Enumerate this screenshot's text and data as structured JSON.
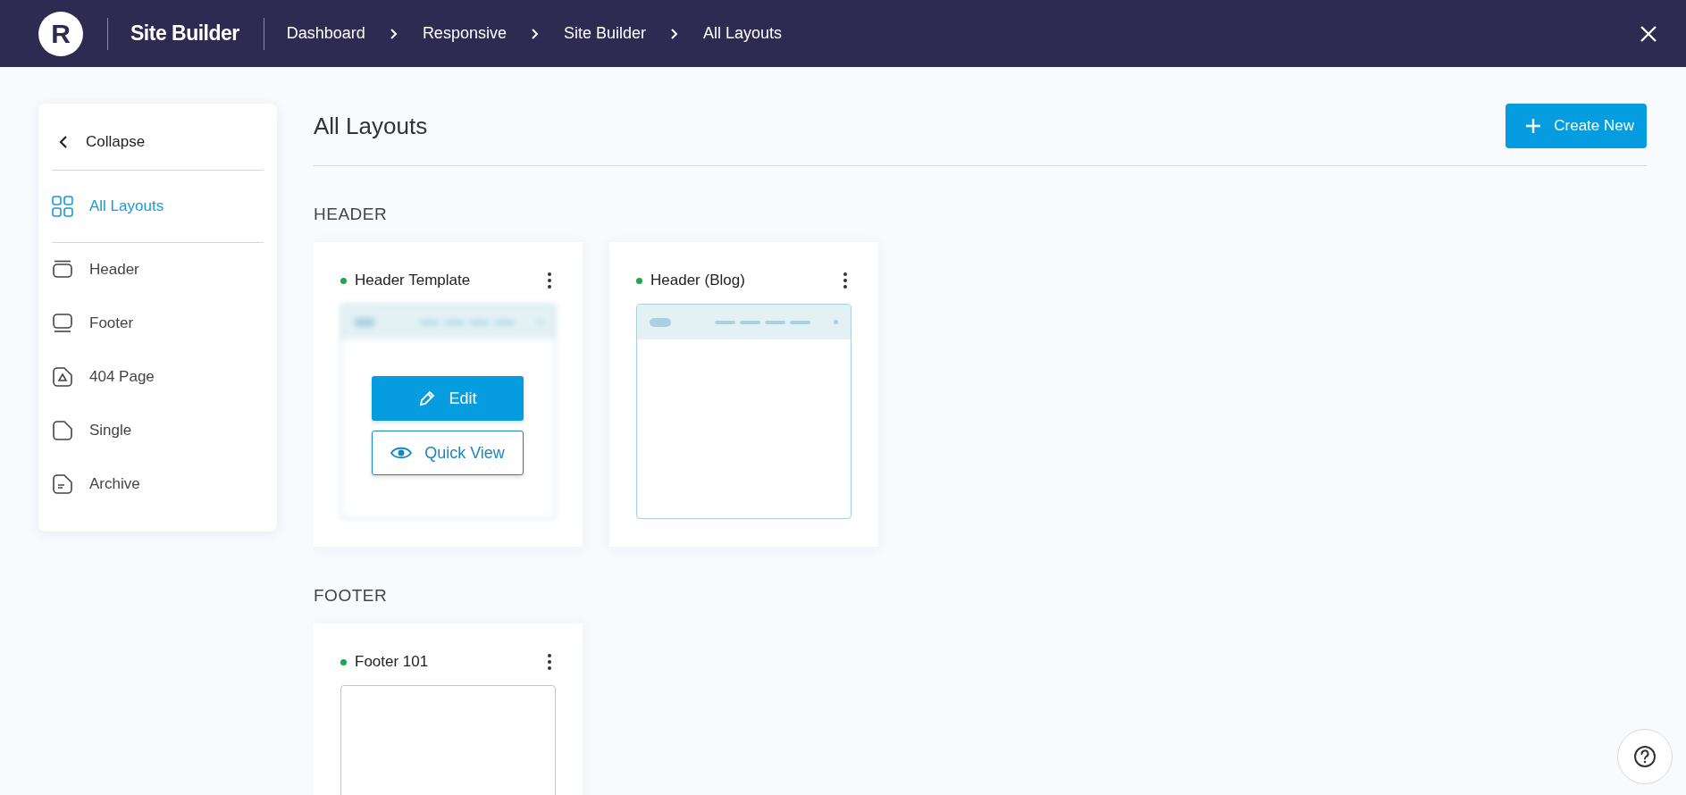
{
  "topbar": {
    "logo": "R",
    "app_title": "Site Builder",
    "breadcrumbs": [
      "Dashboard",
      "Responsive",
      "Site Builder",
      "All Layouts"
    ]
  },
  "sidebar": {
    "collapse_label": "Collapse",
    "items": [
      {
        "kind": "all",
        "label": "All Layouts",
        "selected": true
      },
      {
        "kind": "header",
        "label": "Header",
        "selected": false
      },
      {
        "kind": "footer",
        "label": "Footer",
        "selected": false
      },
      {
        "kind": "notfound",
        "label": "404 Page",
        "selected": false
      },
      {
        "kind": "single",
        "label": "Single",
        "selected": false
      },
      {
        "kind": "archive",
        "label": "Archive",
        "selected": false
      }
    ]
  },
  "main": {
    "title": "All Layouts",
    "create_button": "Create New",
    "sections": [
      {
        "heading": "HEADER",
        "cards": [
          {
            "title": "Header Template",
            "active": true,
            "kind": "header",
            "hovered": true,
            "actions": [
              {
                "kind": "edit",
                "label": "Edit"
              },
              {
                "kind": "view",
                "label": "Quick View"
              }
            ]
          },
          {
            "title": "Header (Blog)",
            "active": true,
            "kind": "header",
            "hovered": false
          }
        ]
      },
      {
        "heading": "FOOTER",
        "cards": [
          {
            "title": "Footer 101",
            "active": true,
            "kind": "blank",
            "hovered": false
          }
        ]
      }
    ]
  }
}
